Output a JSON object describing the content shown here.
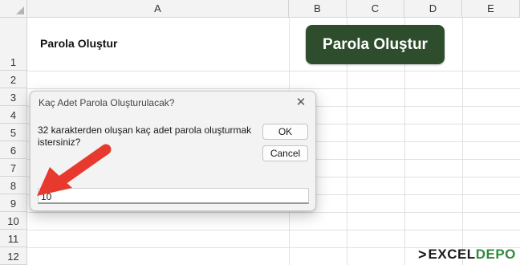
{
  "columns": [
    "A",
    "B",
    "C",
    "D",
    "E"
  ],
  "rows": [
    "1",
    "2",
    "3",
    "4",
    "5",
    "6",
    "7",
    "8",
    "9",
    "10",
    "11",
    "12"
  ],
  "cells": {
    "a1": "Parola Oluştur"
  },
  "sheet_button": {
    "label": "Parola Oluştur",
    "color": "#2d4d2d"
  },
  "dialog": {
    "title": "Kaç Adet Parola Oluşturulacak?",
    "close_icon": "close-icon",
    "prompt": "32 karakterden oluşan kaç adet parola oluşturmak istersiniz?",
    "ok_label": "OK",
    "cancel_label": "Cancel",
    "input_value": "10"
  },
  "annotation": {
    "arrow_icon": "arrow-icon",
    "arrow_color": "#e8392f"
  },
  "logo": {
    "chevron": ">",
    "excel": "EXCEL",
    "depo": "DEPO",
    "accent": "#2f8a3e"
  }
}
